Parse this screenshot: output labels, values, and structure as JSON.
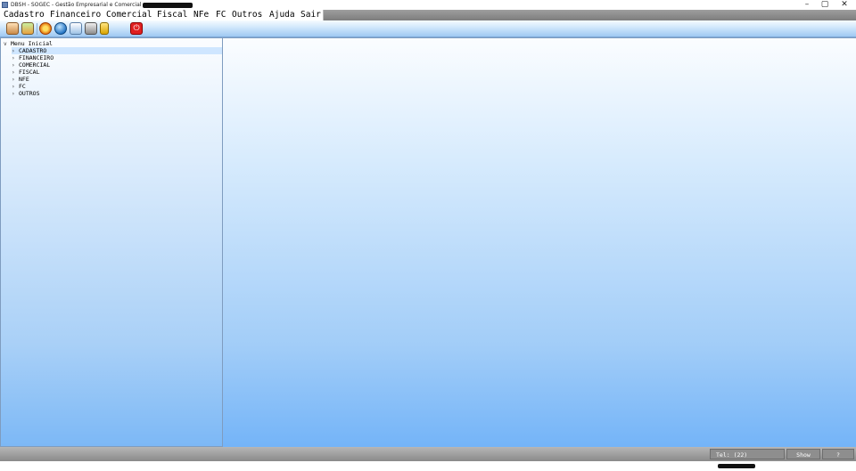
{
  "window": {
    "title": "DBSH - SOGEC - Gestão Empresarial e Comercial",
    "controls": [
      "–",
      "▢",
      "✕"
    ]
  },
  "menu": {
    "items": [
      "Cadastro",
      "Financeiro",
      "Comercial",
      "Fiscal",
      "NFe",
      "FC",
      "Outros",
      "Ajuda",
      "Sair"
    ]
  },
  "toolbar": {
    "icons": [
      "clients-icon",
      "users-icon",
      "orange-circle-icon",
      "globe-icon",
      "shield-icon",
      "computer-icon",
      "lock-icon",
      "power-icon"
    ]
  },
  "tree": {
    "root": "Menu Inicial",
    "children": [
      "CADASTRO",
      "FINANCEIRO",
      "COMERCIAL",
      "FISCAL",
      "NFE",
      "FC",
      "OUTROS"
    ],
    "selected_index": 0
  },
  "status": {
    "phone_label": "Tel: (22)",
    "show_label": "Show",
    "help_label": "?"
  },
  "colors": {
    "accent": "#9fc8f2",
    "power": "#e02020"
  }
}
